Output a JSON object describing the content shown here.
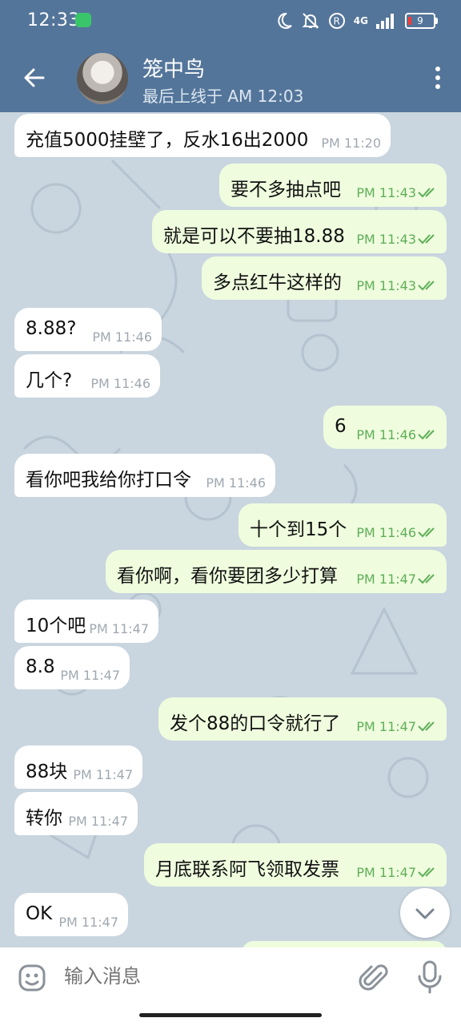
{
  "status_bar": {
    "time": "12:33",
    "network": "4G",
    "battery": "9"
  },
  "header": {
    "name": "笼中鸟",
    "last_seen": "最后上线于 AM 12:03"
  },
  "messages": [
    {
      "dir": "in",
      "text": "充值5000挂壁了，反水16出2000",
      "time": "PM 11:20"
    },
    {
      "dir": "out",
      "text": "要不多抽点吧",
      "time": "PM 11:43"
    },
    {
      "dir": "out",
      "text": "就是可以不要抽18.88",
      "time": "PM 11:43"
    },
    {
      "dir": "out",
      "text": "多点红牛这样的",
      "time": "PM 11:43"
    },
    {
      "dir": "in",
      "text": "8.88?",
      "time": "PM 11:46"
    },
    {
      "dir": "in",
      "text": "几个?",
      "time": "PM 11:46"
    },
    {
      "dir": "out",
      "text": "6",
      "time": "PM 11:46"
    },
    {
      "dir": "in",
      "text": "看你吧我给你打口令",
      "time": "PM 11:46"
    },
    {
      "dir": "out",
      "text": "十个到15个",
      "time": "PM 11:46"
    },
    {
      "dir": "out",
      "text": "看你啊，看你要团多少打算",
      "time": "PM 11:47"
    },
    {
      "dir": "in",
      "text": "10个吧",
      "time": "PM 11:47"
    },
    {
      "dir": "in",
      "text": "8.8",
      "time": "PM 11:47"
    },
    {
      "dir": "out",
      "text": "发个88的口令就行了",
      "time": "PM 11:47"
    },
    {
      "dir": "in",
      "text": "88块",
      "time": "PM 11:47"
    },
    {
      "dir": "in",
      "text": "转你",
      "time": "PM 11:47"
    },
    {
      "dir": "out",
      "text": "月底联系阿飞领取发票",
      "time": "PM 11:47"
    },
    {
      "dir": "in",
      "text": "OK",
      "time": "PM 11:47"
    }
  ],
  "input": {
    "placeholder": "输入消息"
  },
  "colors": {
    "header": "#54759a",
    "outgoing_bubble": "#effdde",
    "incoming_bubble": "#ffffff",
    "check": "#5fae58"
  },
  "icons": [
    "back-arrow-icon",
    "more-vert-icon",
    "emoji-icon",
    "attach-icon",
    "mic-icon",
    "chevron-down-icon",
    "double-check-icon"
  ]
}
